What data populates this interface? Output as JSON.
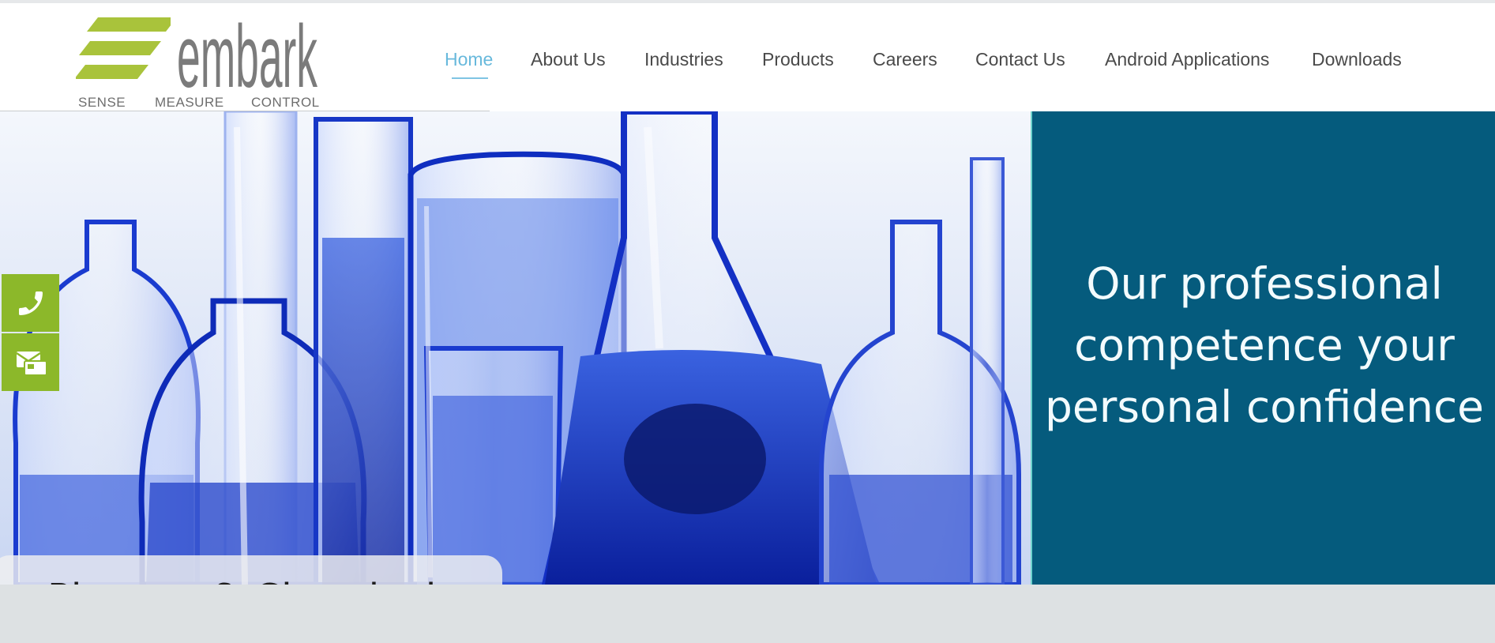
{
  "logo": {
    "word": "embark",
    "tagline": [
      "SENSE",
      "MEASURE",
      "CONTROL"
    ],
    "color_green": "#a9c33b",
    "color_grey": "#7b7b7b"
  },
  "nav": {
    "items": [
      {
        "label": "Home",
        "active": true
      },
      {
        "label": "About Us"
      },
      {
        "label": "Industries"
      },
      {
        "label": "Products"
      },
      {
        "label": "Careers"
      },
      {
        "label": "Contact Us"
      },
      {
        "label": "Android Applications"
      },
      {
        "label": "Downloads"
      }
    ],
    "active_color": "#68b9dc"
  },
  "hero": {
    "caption": "Pharma & Chemical",
    "slides": 5,
    "active_slide": 4
  },
  "side_panel": {
    "lines": [
      "Our professional",
      "competence your",
      "personal confidence"
    ],
    "background": "#055b7d"
  },
  "contact_buttons": [
    {
      "icon": "phone-icon"
    },
    {
      "icon": "mail-icon"
    }
  ],
  "colors": {
    "accent_green": "#8cb82a",
    "footer_band": "#dde1e3"
  }
}
